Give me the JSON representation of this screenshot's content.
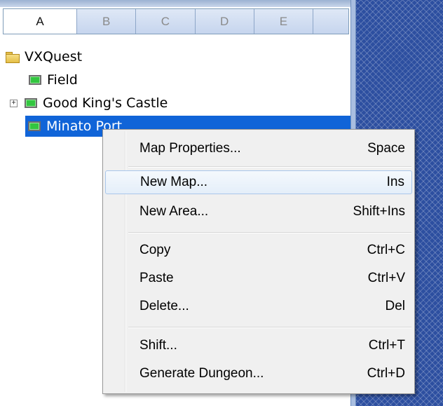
{
  "tabs": [
    {
      "label": "A",
      "active": true
    },
    {
      "label": "B",
      "active": false
    },
    {
      "label": "C",
      "active": false
    },
    {
      "label": "D",
      "active": false
    },
    {
      "label": "E",
      "active": false
    }
  ],
  "tree": {
    "root": {
      "label": "VXQuest",
      "icon": "folder-icon"
    },
    "items": [
      {
        "label": "Field",
        "icon": "map-icon",
        "expandable": false,
        "selected": false
      },
      {
        "label": "Good King's Castle",
        "icon": "map-icon",
        "expandable": true,
        "expander_glyph": "+",
        "selected": false
      },
      {
        "label": "Minato Port",
        "icon": "map-icon",
        "expandable": false,
        "selected": true
      }
    ]
  },
  "context_menu": {
    "groups": [
      [
        {
          "label": "Map Properties...",
          "shortcut": "Space"
        }
      ],
      [
        {
          "label": "New Map...",
          "shortcut": "Ins",
          "highlighted": true
        },
        {
          "label": "New Area...",
          "shortcut": "Shift+Ins"
        }
      ],
      [
        {
          "label": "Copy",
          "shortcut": "Ctrl+C"
        },
        {
          "label": "Paste",
          "shortcut": "Ctrl+V"
        },
        {
          "label": "Delete...",
          "shortcut": "Del"
        }
      ],
      [
        {
          "label": "Shift...",
          "shortcut": "Ctrl+T"
        },
        {
          "label": "Generate Dungeon...",
          "shortcut": "Ctrl+D"
        }
      ]
    ]
  },
  "colors": {
    "selection": "#1064d8",
    "menu_background": "#f0f0f0",
    "menu_highlight_border": "#a9c6ea",
    "right_panel": "#2d4fa0"
  }
}
